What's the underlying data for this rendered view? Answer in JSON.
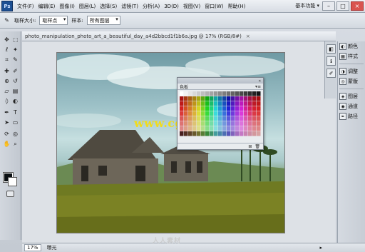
{
  "app": {
    "logo": "Ps",
    "workspace": "基本功能 ▾"
  },
  "menubar": {
    "items": [
      "文件(F)",
      "编辑(E)",
      "图像(I)",
      "图层(L)",
      "选择(S)",
      "滤镜(T)",
      "分析(A)",
      "3D(D)",
      "视图(V)",
      "窗口(W)",
      "帮助(H)"
    ],
    "zoom": "17%"
  },
  "optbar": {
    "select1": "取样大小:",
    "select1_value": "取样点",
    "select2_label": "样本:",
    "select2_value": "所有图层"
  },
  "document": {
    "tab_title": "photo_manipulation_photo_art_a_beautiful_day_a4d2bbcd1f1b6a.jpg @ 17% (RGB/8#)"
  },
  "swatches": {
    "tab": "色板",
    "menu": "▾≡"
  },
  "watermark": {
    "text": "www.cg-ku.com"
  },
  "right_panel": {
    "items": [
      {
        "label": "颜色",
        "icon": "color-icon"
      },
      {
        "label": "样式",
        "icon": "styles-icon"
      },
      {
        "label": "调整",
        "icon": "adjustments-icon"
      },
      {
        "label": "蒙版",
        "icon": "masks-icon"
      },
      {
        "label": "图层",
        "icon": "layers-icon"
      },
      {
        "label": "通道",
        "icon": "channels-icon"
      },
      {
        "label": "路径",
        "icon": "paths-icon"
      }
    ]
  },
  "statusbar": {
    "zoom": "17%",
    "info": "曝光"
  },
  "bottom_logo": "人人素材",
  "colors": {
    "accent": "#1c4f93",
    "watermark": "#f2dc1a"
  }
}
